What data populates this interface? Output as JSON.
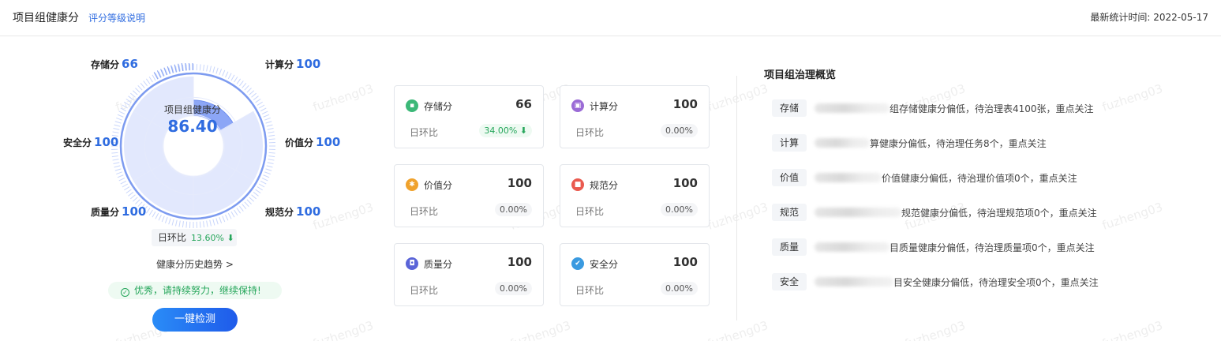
{
  "header": {
    "title": "项目组健康分",
    "rule_link": "评分等级说明",
    "stat_time": "最新统计时间: 2022-05-17"
  },
  "radar": {
    "axes": [
      {
        "name": "存储分",
        "value": 66
      },
      {
        "name": "计算分",
        "value": 100
      },
      {
        "name": "价值分",
        "value": 100
      },
      {
        "name": "规范分",
        "value": 100
      },
      {
        "name": "质量分",
        "value": 100
      },
      {
        "name": "安全分",
        "value": 100
      }
    ],
    "center_label": "项目组健康分",
    "center_score": "86.40",
    "accent_color": "#2f6ce0"
  },
  "day_over_day": {
    "label": "日环比",
    "value": "13.60%",
    "direction": "down"
  },
  "trend_link": "健康分历史趋势",
  "notice": "优秀，请持续努力，继续保持!",
  "check_button": "一键检测",
  "cards": [
    {
      "name": "存储分",
      "score": "66",
      "dod_label": "日环比",
      "dod_value": "34.00%",
      "icon": "storage-icon",
      "color": "#3cb878",
      "highlight": true
    },
    {
      "name": "计算分",
      "score": "100",
      "dod_label": "日环比",
      "dod_value": "0.00%",
      "icon": "compute-icon",
      "color": "#9b6bd6",
      "highlight": false
    },
    {
      "name": "价值分",
      "score": "100",
      "dod_label": "日环比",
      "dod_value": "0.00%",
      "icon": "value-icon",
      "color": "#f0a22c",
      "highlight": false
    },
    {
      "name": "规范分",
      "score": "100",
      "dod_label": "日环比",
      "dod_value": "0.00%",
      "icon": "standard-icon",
      "color": "#ea5a4f",
      "highlight": false
    },
    {
      "name": "质量分",
      "score": "100",
      "dod_label": "日环比",
      "dod_value": "0.00%",
      "icon": "quality-icon",
      "color": "#5a64d8",
      "highlight": false
    },
    {
      "name": "安全分",
      "score": "100",
      "dod_label": "日环比",
      "dod_value": "0.00%",
      "icon": "security-icon",
      "color": "#3a9ae0",
      "highlight": false
    }
  ],
  "overview": {
    "title": "项目组治理概览",
    "rows": [
      {
        "tag": "存储",
        "text": "组存储健康分偏低，待治理表4100张，重点关注"
      },
      {
        "tag": "计算",
        "text": "算健康分偏低，待治理任务8个，重点关注"
      },
      {
        "tag": "价值",
        "text": "价值健康分偏低，待治理价值项0个，重点关注"
      },
      {
        "tag": "规范",
        "text": "规范健康分偏低，待治理规范项0个，重点关注"
      },
      {
        "tag": "质量",
        "text": "目质量健康分偏低，待治理质量项0个，重点关注"
      },
      {
        "tag": "安全",
        "text": "目安全健康分偏低，待治理安全项0个，重点关注"
      }
    ]
  },
  "watermark": "fuzheng03"
}
